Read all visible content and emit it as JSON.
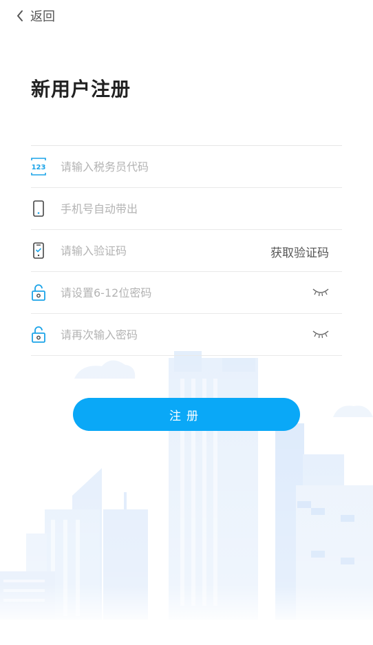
{
  "header": {
    "back_label": "返回"
  },
  "title": "新用户注册",
  "form": {
    "tax_id": {
      "placeholder": "请输入税务员代码",
      "icon": "number-123-icon"
    },
    "phone": {
      "placeholder": "手机号自动带出",
      "icon": "phone-icon"
    },
    "code": {
      "placeholder": "请输入验证码",
      "icon": "verify-phone-icon",
      "action_label": "获取验证码"
    },
    "password": {
      "placeholder": "请设置6-12位密码",
      "icon": "lock-icon"
    },
    "confirm": {
      "placeholder": "请再次输入密码",
      "icon": "lock-icon"
    }
  },
  "submit_label": "注册",
  "colors": {
    "accent": "#0aa8f7",
    "icon_blue": "#1aa3e8",
    "city_tint": "#dbe9fb"
  }
}
